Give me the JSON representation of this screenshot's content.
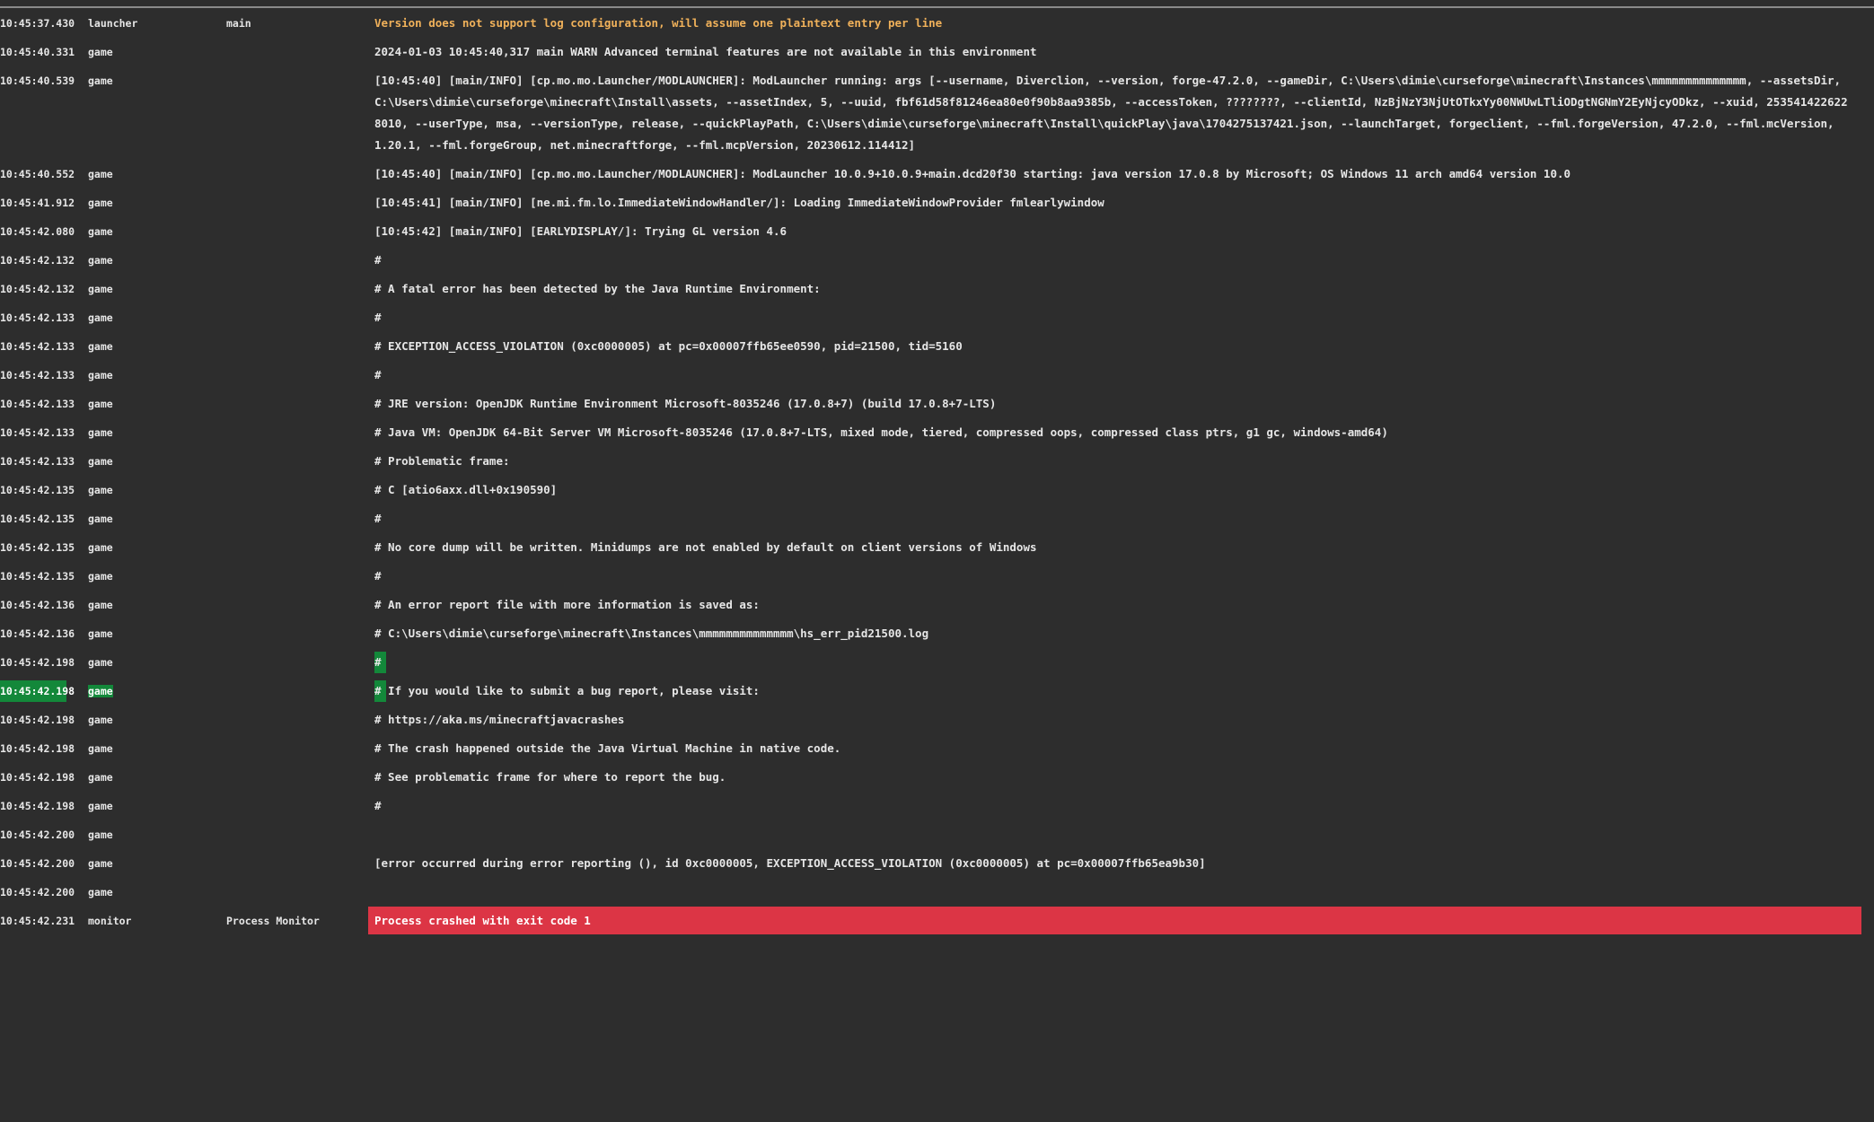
{
  "colors": {
    "background": "#2d2d2d",
    "text": "#e6e6e6",
    "warning_text": "#f0b15a",
    "error_background": "#dc3545",
    "highlight_background": "#13883a"
  },
  "log": {
    "rows": [
      {
        "time": "10:45:37.430",
        "source": "launcher",
        "thread": "main",
        "message": "Version does not support log configuration, will assume one plaintext entry per line"
      },
      {
        "time": "10:45:40.331",
        "source": "game",
        "thread": "",
        "message": "2024-01-03 10:45:40,317 main WARN Advanced terminal features are not available in this environment"
      },
      {
        "time": "10:45:40.539",
        "source": "game",
        "thread": "",
        "message": "[10:45:40] [main/INFO] [cp.mo.mo.Launcher/MODLAUNCHER]: ModLauncher running: args [--username, Diverclion, --version, forge-47.2.0, --gameDir, C:\\Users\\dimie\\curseforge\\minecraft\\Instances\\mmmmmmmmmmmmmm, --assetsDir, C:\\Users\\dimie\\curseforge\\minecraft\\Install\\assets, --assetIndex, 5, --uuid, fbf61d58f81246ea80e0f90b8aa9385b, --accessToken, ????????, --clientId, NzBjNzY3NjUtOTkxYy00NWUwLTliODgtNGNmY2EyNjcyODkz, --xuid, 2535414226228010, --userType, msa, --versionType, release, --quickPlayPath, C:\\Users\\dimie\\curseforge\\minecraft\\Install\\quickPlay\\java\\1704275137421.json, --launchTarget, forgeclient, --fml.forgeVersion, 47.2.0, --fml.mcVersion, 1.20.1, --fml.forgeGroup, net.minecraftforge, --fml.mcpVersion, 20230612.114412]"
      },
      {
        "time": "10:45:40.552",
        "source": "game",
        "thread": "",
        "message": "[10:45:40] [main/INFO] [cp.mo.mo.Launcher/MODLAUNCHER]: ModLauncher 10.0.9+10.0.9+main.dcd20f30 starting: java version 17.0.8 by Microsoft; OS Windows 11 arch amd64 version 10.0"
      },
      {
        "time": "10:45:41.912",
        "source": "game",
        "thread": "",
        "message": "[10:45:41] [main/INFO] [ne.mi.fm.lo.ImmediateWindowHandler/]: Loading ImmediateWindowProvider fmlearlywindow"
      },
      {
        "time": "10:45:42.080",
        "source": "game",
        "thread": "",
        "message": "[10:45:42] [main/INFO] [EARLYDISPLAY/]: Trying GL version 4.6"
      },
      {
        "time": "10:45:42.132",
        "source": "game",
        "thread": "",
        "message": "#"
      },
      {
        "time": "10:45:42.132",
        "source": "game",
        "thread": "",
        "message": "# A fatal error has been detected by the Java Runtime Environment:"
      },
      {
        "time": "10:45:42.133",
        "source": "game",
        "thread": "",
        "message": "#"
      },
      {
        "time": "10:45:42.133",
        "source": "game",
        "thread": "",
        "message": "#  EXCEPTION_ACCESS_VIOLATION (0xc0000005) at pc=0x00007ffb65ee0590, pid=21500, tid=5160"
      },
      {
        "time": "10:45:42.133",
        "source": "game",
        "thread": "",
        "message": "#"
      },
      {
        "time": "10:45:42.133",
        "source": "game",
        "thread": "",
        "message": "# JRE version: OpenJDK Runtime Environment Microsoft-8035246 (17.0.8+7) (build 17.0.8+7-LTS)"
      },
      {
        "time": "10:45:42.133",
        "source": "game",
        "thread": "",
        "message": "# Java VM: OpenJDK 64-Bit Server VM Microsoft-8035246 (17.0.8+7-LTS, mixed mode, tiered, compressed oops, compressed class ptrs, g1 gc, windows-amd64)"
      },
      {
        "time": "10:45:42.133",
        "source": "game",
        "thread": "",
        "message": "# Problematic frame:"
      },
      {
        "time": "10:45:42.135",
        "source": "game",
        "thread": "",
        "message": "# C  [atio6axx.dll+0x190590]"
      },
      {
        "time": "10:45:42.135",
        "source": "game",
        "thread": "",
        "message": "#"
      },
      {
        "time": "10:45:42.135",
        "source": "game",
        "thread": "",
        "message": "# No core dump will be written. Minidumps are not enabled by default on client versions of Windows"
      },
      {
        "time": "10:45:42.135",
        "source": "game",
        "thread": "",
        "message": "#"
      },
      {
        "time": "10:45:42.136",
        "source": "game",
        "thread": "",
        "message": "# An error report file with more information is saved as:"
      },
      {
        "time": "10:45:42.136",
        "source": "game",
        "thread": "",
        "message": "# C:\\Users\\dimie\\curseforge\\minecraft\\Instances\\mmmmmmmmmmmmmm\\hs_err_pid21500.log"
      },
      {
        "time": "10:45:42.198",
        "source": "game",
        "thread": "",
        "message": "#"
      },
      {
        "time": "10:45:42.198",
        "source": "game",
        "thread": "",
        "message": "# If you would like to submit a bug report, please visit:"
      },
      {
        "time": "10:45:42.198",
        "source": "game",
        "thread": "",
        "message": "#   https://aka.ms/minecraftjavacrashes"
      },
      {
        "time": "10:45:42.198",
        "source": "game",
        "thread": "",
        "message": "# The crash happened outside the Java Virtual Machine in native code."
      },
      {
        "time": "10:45:42.198",
        "source": "game",
        "thread": "",
        "message": "# See problematic frame for where to report the bug."
      },
      {
        "time": "10:45:42.198",
        "source": "game",
        "thread": "",
        "message": "#"
      },
      {
        "time": "10:45:42.200",
        "source": "game",
        "thread": "",
        "message": ""
      },
      {
        "time": "10:45:42.200",
        "source": "game",
        "thread": "",
        "message": "[error occurred during error reporting (), id 0xc0000005, EXCEPTION_ACCESS_VIOLATION (0xc0000005) at pc=0x00007ffb65ea9b30]"
      },
      {
        "time": "10:45:42.200",
        "source": "game",
        "thread": "",
        "message": ""
      },
      {
        "time": "10:45:42.231",
        "source": "monitor",
        "thread": "Process Monitor",
        "message": "Process crashed with exit code 1"
      }
    ]
  }
}
